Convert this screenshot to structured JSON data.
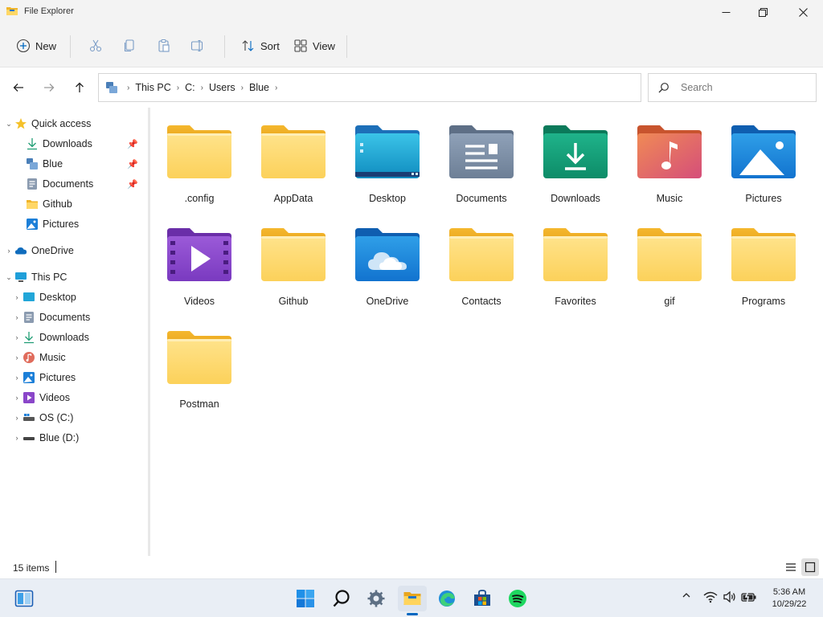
{
  "window": {
    "title": "File Explorer",
    "accent": "#0067c0"
  },
  "toolbar": {
    "new_label": "New",
    "sort_label": "Sort",
    "view_label": "View"
  },
  "address": {
    "crumbs": [
      "This PC",
      "C:",
      "Users",
      "Blue"
    ]
  },
  "search": {
    "placeholder": "Search"
  },
  "sidebar": {
    "quick_access": {
      "label": "Quick access",
      "items": [
        {
          "label": "Downloads",
          "icon": "download-icon",
          "pinned": true
        },
        {
          "label": "Blue",
          "icon": "user-folder-icon",
          "pinned": true
        },
        {
          "label": "Documents",
          "icon": "documents-icon",
          "pinned": true
        },
        {
          "label": "Github",
          "icon": "folder-icon",
          "pinned": false
        },
        {
          "label": "Pictures",
          "icon": "pictures-icon",
          "pinned": false
        }
      ]
    },
    "onedrive": {
      "label": "OneDrive"
    },
    "this_pc": {
      "label": "This PC",
      "items": [
        {
          "label": "Desktop",
          "icon": "desktop-icon"
        },
        {
          "label": "Documents",
          "icon": "documents-icon"
        },
        {
          "label": "Downloads",
          "icon": "download-icon"
        },
        {
          "label": "Music",
          "icon": "music-icon"
        },
        {
          "label": "Pictures",
          "icon": "pictures-icon"
        },
        {
          "label": "Videos",
          "icon": "videos-icon"
        },
        {
          "label": "OS (C:)",
          "icon": "drive-icon"
        },
        {
          "label": "Blue (D:)",
          "icon": "drive-icon"
        }
      ]
    }
  },
  "folders": [
    {
      "name": ".config",
      "icon": "folder-icon"
    },
    {
      "name": "AppData",
      "icon": "folder-icon"
    },
    {
      "name": "Desktop",
      "icon": "desktop-folder-icon"
    },
    {
      "name": "Documents",
      "icon": "documents-folder-icon"
    },
    {
      "name": "Downloads",
      "icon": "downloads-folder-icon"
    },
    {
      "name": "Music",
      "icon": "music-folder-icon"
    },
    {
      "name": "Pictures",
      "icon": "pictures-folder-icon"
    },
    {
      "name": "Videos",
      "icon": "videos-folder-icon"
    },
    {
      "name": "Github",
      "icon": "folder-icon"
    },
    {
      "name": "OneDrive",
      "icon": "onedrive-folder-icon"
    },
    {
      "name": "Contacts",
      "icon": "folder-icon"
    },
    {
      "name": "Favorites",
      "icon": "folder-icon"
    },
    {
      "name": "gif",
      "icon": "folder-icon"
    },
    {
      "name": "Programs",
      "icon": "folder-icon"
    },
    {
      "name": "Postman",
      "icon": "folder-icon"
    }
  ],
  "status": {
    "item_count": "15 items"
  },
  "taskbar": {
    "time": "5:36 AM",
    "date": "10/29/22"
  }
}
